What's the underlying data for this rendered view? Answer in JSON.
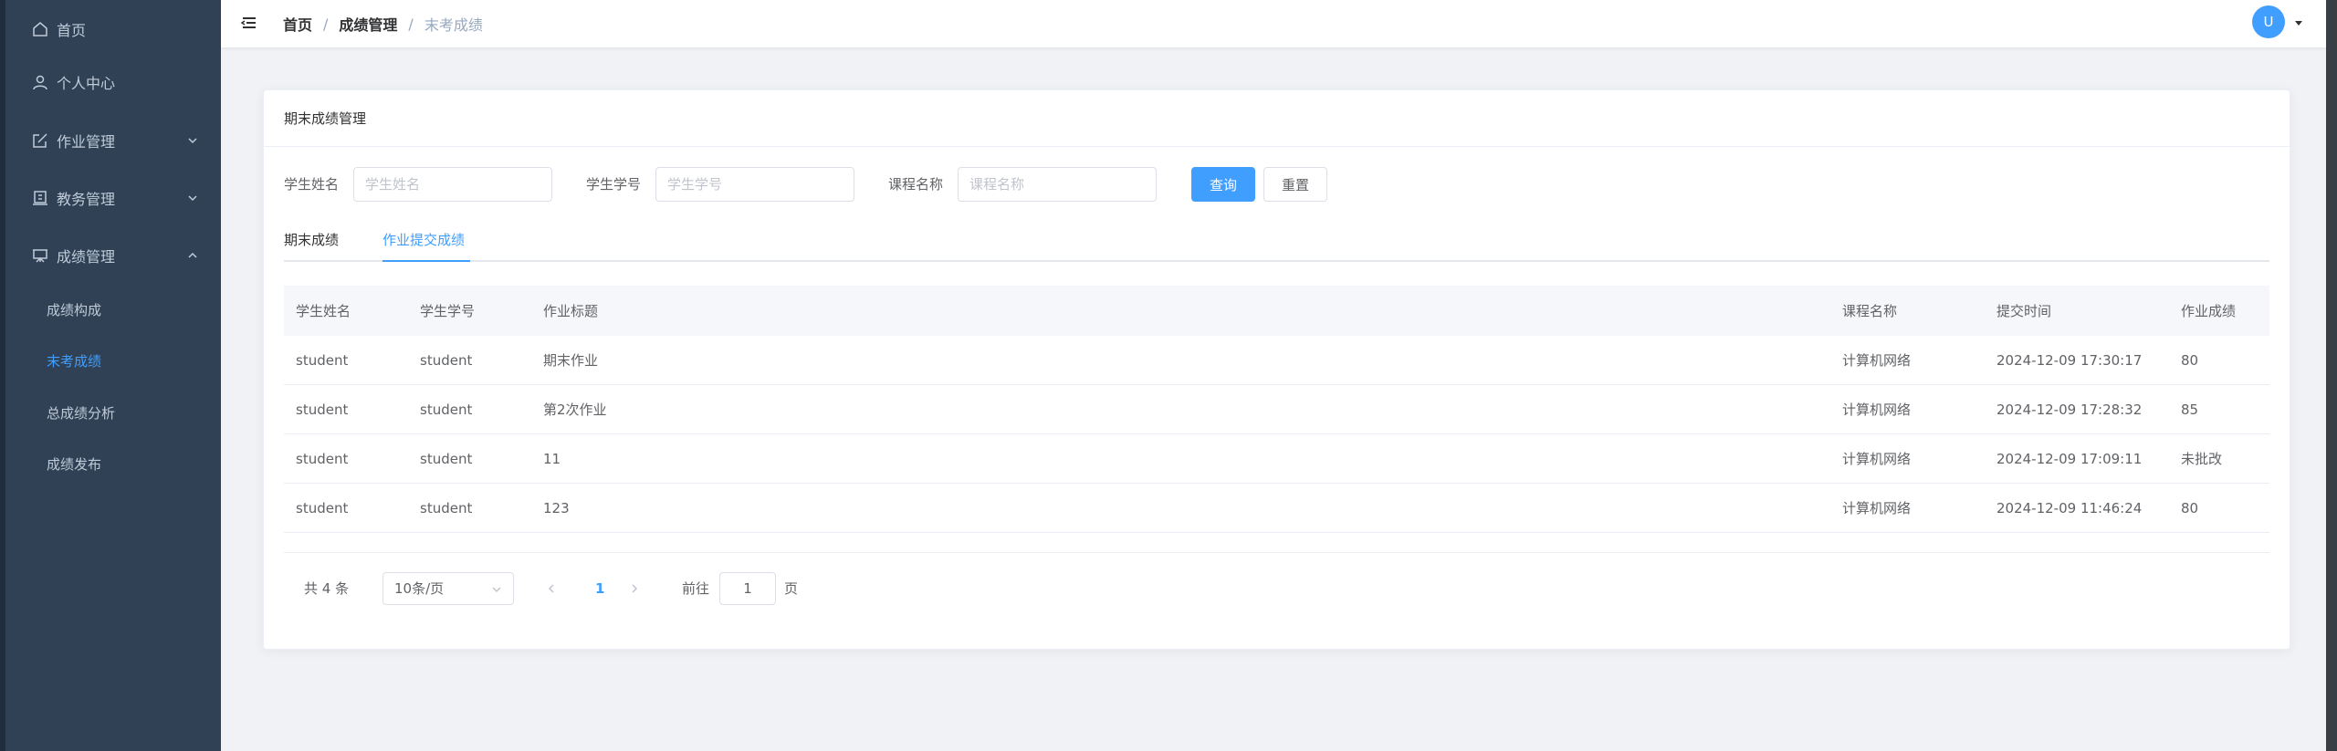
{
  "sidebar": {
    "items": [
      {
        "label": "首页",
        "icon": "home-icon"
      },
      {
        "label": "个人中心",
        "icon": "user-icon"
      },
      {
        "label": "作业管理",
        "icon": "edit-icon"
      },
      {
        "label": "教务管理",
        "icon": "office-building-icon"
      },
      {
        "label": "成绩管理",
        "icon": "data-board-icon"
      }
    ],
    "subitems": [
      {
        "label": "成绩构成"
      },
      {
        "label": "末考成绩"
      },
      {
        "label": "总成绩分析"
      },
      {
        "label": "成绩发布"
      }
    ]
  },
  "header": {
    "breadcrumb": [
      "首页",
      "成绩管理",
      "末考成绩"
    ],
    "separator": "/",
    "avatar_text": "U"
  },
  "card": {
    "title": "期末成绩管理"
  },
  "search": {
    "name_label": "学生姓名",
    "name_placeholder": "学生姓名",
    "id_label": "学生学号",
    "id_placeholder": "学生学号",
    "course_label": "课程名称",
    "course_placeholder": "课程名称",
    "query_button": "查询",
    "reset_button": "重置"
  },
  "tabs": [
    {
      "label": "期末成绩",
      "active": false
    },
    {
      "label": "作业提交成绩",
      "active": true
    }
  ],
  "table": {
    "columns": [
      "学生姓名",
      "学生学号",
      "作业标题",
      "课程名称",
      "提交时间",
      "作业成绩"
    ],
    "rows": [
      [
        "student",
        "student",
        "期末作业",
        "计算机网络",
        "2024-12-09 17:30:17",
        "80"
      ],
      [
        "student",
        "student",
        "第2次作业",
        "计算机网络",
        "2024-12-09 17:28:32",
        "85"
      ],
      [
        "student",
        "student",
        "11",
        "计算机网络",
        "2024-12-09 17:09:11",
        "未批改"
      ],
      [
        "student",
        "student",
        "123",
        "计算机网络",
        "2024-12-09 11:46:24",
        "80"
      ]
    ]
  },
  "pagination": {
    "total": "共 4 条",
    "page_size": "10条/页",
    "current_page": "1",
    "goto_label": "前往",
    "goto_value": "1",
    "page_suffix": "页"
  },
  "colors": {
    "accent": "#409eff",
    "sidebar_bg": "#304156",
    "sidebar_text": "#bfcbd9"
  }
}
